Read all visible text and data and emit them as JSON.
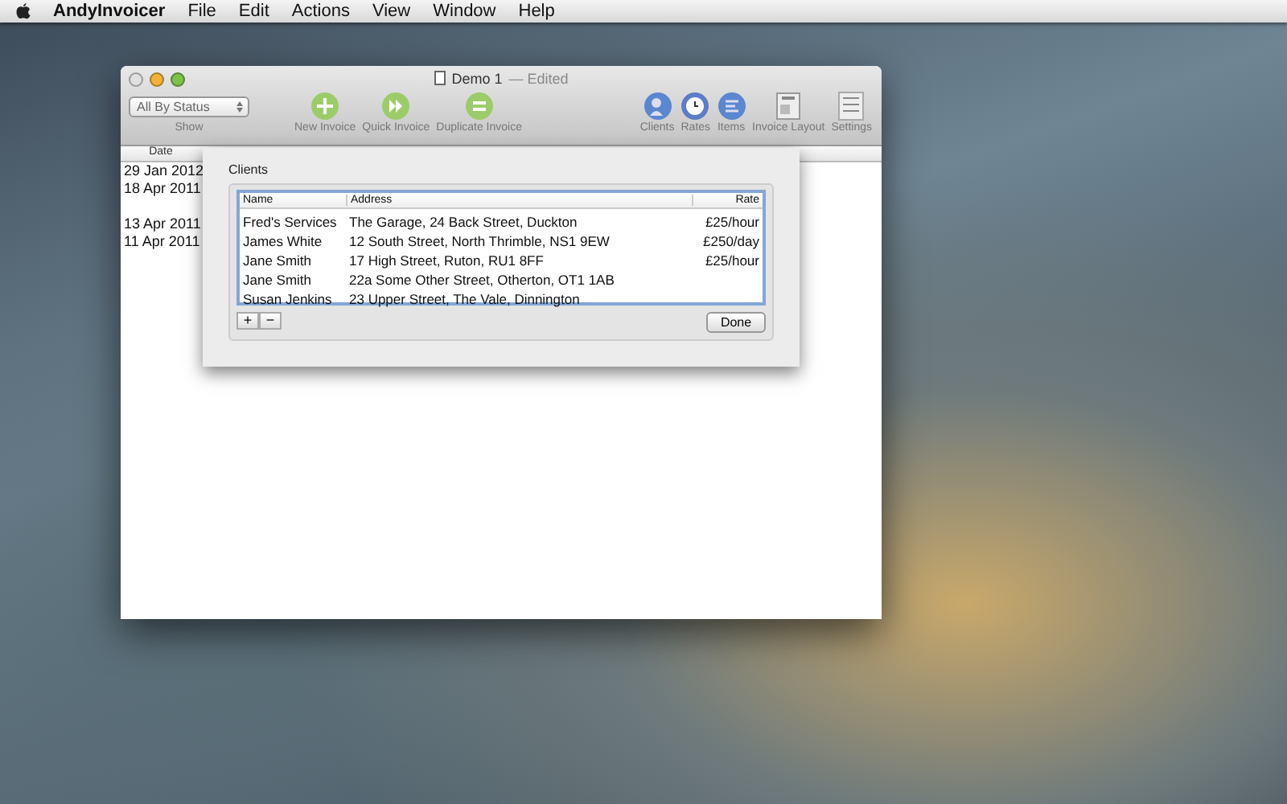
{
  "menu_bar": {
    "app_name": "AndyInvoicer",
    "items": [
      "File",
      "Edit",
      "Actions",
      "View",
      "Window",
      "Help"
    ]
  },
  "window": {
    "title": "Demo 1",
    "status": "— Edited"
  },
  "toolbar": {
    "filter": {
      "value": "All By Status",
      "label": "Show"
    },
    "left_buttons": [
      {
        "label": "New Invoice",
        "kind": "plus"
      },
      {
        "label": "Quick Invoice",
        "kind": "forward"
      },
      {
        "label": "Duplicate Invoice",
        "kind": "equals"
      }
    ],
    "right_buttons": [
      {
        "label": "Clients",
        "kind": "clients"
      },
      {
        "label": "Rates",
        "kind": "clock"
      },
      {
        "label": "Items",
        "kind": "items"
      },
      {
        "label": "Invoice Layout",
        "kind": "layout"
      },
      {
        "label": "Settings",
        "kind": "settings"
      }
    ]
  },
  "invoice_list": {
    "columns": [
      "Date"
    ],
    "rows": [
      "29 Jan 2012",
      "18 Apr 2011",
      "",
      "13 Apr 2011",
      "11 Apr 2011"
    ]
  },
  "clients_sheet": {
    "title": "Clients",
    "columns": [
      "Name",
      "Address",
      "Rate"
    ],
    "rows": [
      [
        "Fred's Services",
        "The Garage, 24 Back Street, Duckton",
        "£25/hour"
      ],
      [
        "James White",
        "12 South Street, North Thrimble, NS1 9EW",
        "£250/day"
      ],
      [
        "Jane Smith",
        "17 High Street, Ruton, RU1 8FF",
        "£25/hour"
      ],
      [
        "Jane Smith",
        "22a Some Other Street, Otherton, OT1 1AB",
        ""
      ],
      [
        "Susan Jenkins",
        "23 Upper Street, The Vale, Dinnington",
        ""
      ]
    ],
    "add_button": "+",
    "remove_button": "−",
    "done_button": "Done"
  }
}
